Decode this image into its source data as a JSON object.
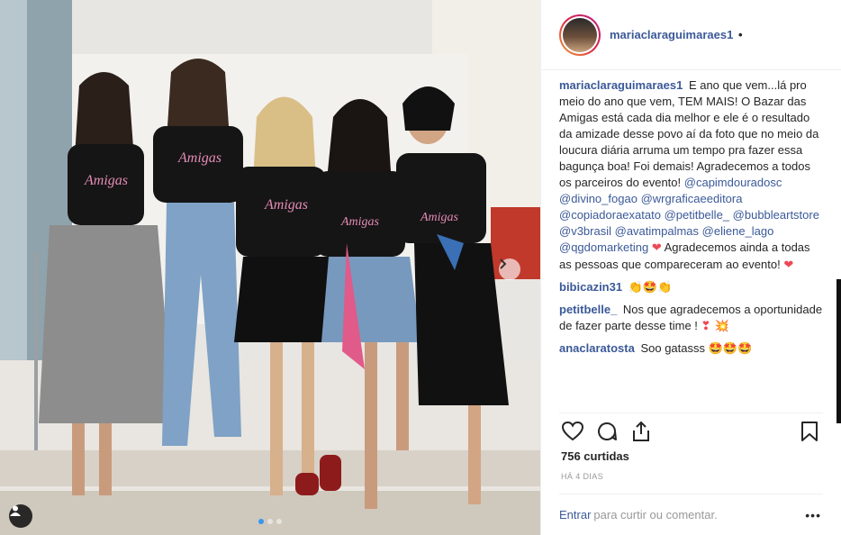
{
  "post": {
    "username": "mariaclaraguimaraes1",
    "header_separator": "•",
    "caption_lines": [
      "E ano que vem...lá pro meio do ano que vem, TEM MAIS! O Bazar das Amigas está cada dia melhor e ele é o resultado da amizade desse povo aí da foto que no meio da loucura diária arruma um tempo pra fazer essa bagunça boa! Foi demais! Agradecemos a todos os parceiros do evento!"
    ],
    "mentions": [
      "@capimdouradosc",
      "@divino_fogao",
      "@wrgraficaeeditora",
      "@copiadoraexatato",
      "@petitbelle_",
      "@bubbleartstore",
      "@v3brasil",
      "@avatimpalmas",
      "@eliene_lago",
      "@qgdomarketing"
    ],
    "caption_emoji_1": "❤",
    "caption_tail": "Agradecemos ainda a todas as pessoas que compareceram ao evento!",
    "caption_emoji_2": "❤"
  },
  "comments": [
    {
      "user": "bibicazin31",
      "text": "👏🤩👏"
    },
    {
      "user": "petitbelle_",
      "text": "Nos que agradecemos a oportunidade de fazer parte desse time !",
      "emoji": "❣ 💥"
    },
    {
      "user": "anaclaratosta",
      "text": "Soo gatasss",
      "emoji": "🤩🤩🤩"
    }
  ],
  "likes": "756 curtidas",
  "date": "HÁ 4 DIAS",
  "add_comment": {
    "login_link": "Entrar",
    "placeholder": "para curtir ou comentar."
  },
  "more_options": "•••",
  "icons": {
    "like": "heart-icon",
    "comment": "comment-icon",
    "share": "share-icon",
    "save": "bookmark-icon",
    "next": "chevron-right-icon",
    "tagged": "user-tag-icon"
  },
  "colors": {
    "link": "#3b5998",
    "carousel_active": "#3897f0",
    "emoji_heart": "#ed4956"
  }
}
